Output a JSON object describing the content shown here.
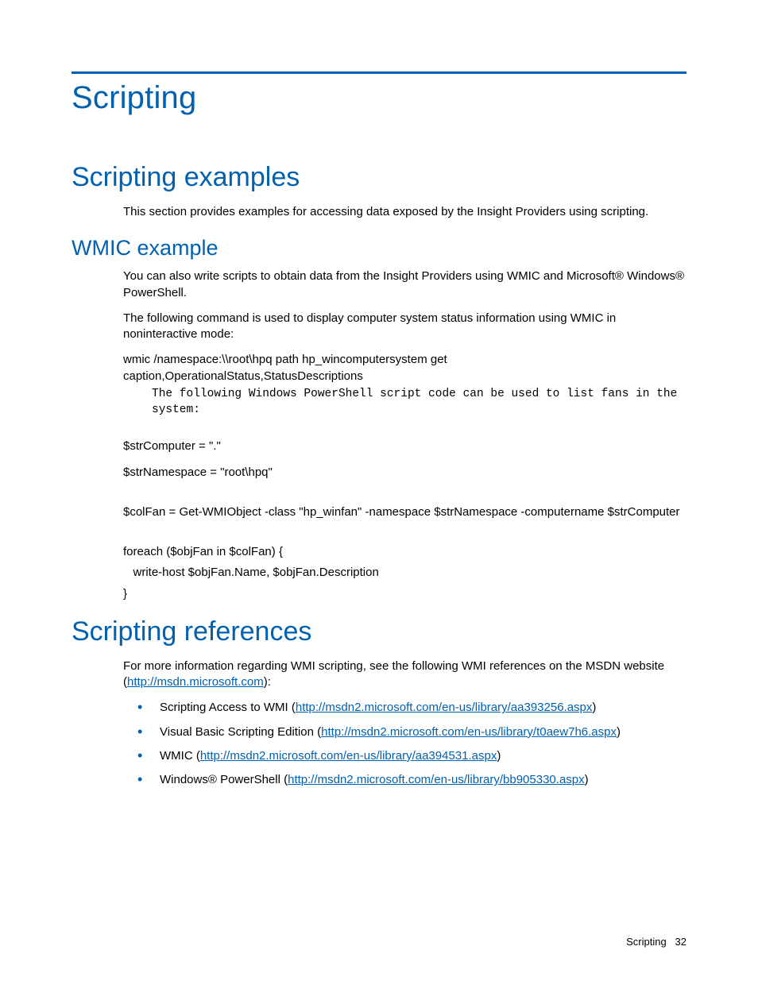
{
  "page_title": "Scripting",
  "s1": {
    "heading": "Scripting examples",
    "intro": "This section provides examples for accessing data exposed by the Insight Providers using scripting.",
    "sub": {
      "heading": "WMIC example",
      "p1": "You can also write scripts to obtain data from the Insight Providers using WMIC and Microsoft® Windows® PowerShell.",
      "p2": "The following command is used to display computer system status information using WMIC in noninteractive mode:",
      "cmd1_l1": "wmic /namespace:\\\\root\\hpq path hp_wincomputersystem get",
      "cmd1_l2": "caption,OperationalStatus,StatusDescriptions",
      "mono": "The following Windows PowerShell script code can be used to list fans in the system:",
      "ps1": "$strComputer = \".\"",
      "ps2": "$strNamespace = \"root\\hpq\"",
      "ps3": "$colFan = Get-WMIObject -class \"hp_winfan\" -namespace $strNamespace -computername $strComputer",
      "ps4": "foreach ($objFan in $colFan) {",
      "ps5": "   write-host $objFan.Name, $objFan.Description",
      "ps6": "}"
    }
  },
  "s2": {
    "heading": "Scripting references",
    "intro_pre": "For more information regarding WMI scripting, see the following WMI references on the MSDN website (",
    "intro_link": "http://msdn.microsoft.com",
    "intro_post": "):",
    "items": [
      {
        "label": "Scripting Access to WMI (",
        "url": "http://msdn2.microsoft.com/en-us/library/aa393256.aspx",
        "tail": ")"
      },
      {
        "label": "Visual Basic Scripting Edition (",
        "url": "http://msdn2.microsoft.com/en-us/library/t0aew7h6.aspx",
        "tail": ")"
      },
      {
        "label": "WMIC (",
        "url": "http://msdn2.microsoft.com/en-us/library/aa394531.aspx",
        "tail": ")"
      },
      {
        "label": "Windows® PowerShell (",
        "url": "http://msdn2.microsoft.com/en-us/library/bb905330.aspx",
        "tail": ")"
      }
    ]
  },
  "footer": {
    "section": "Scripting",
    "page": "32"
  }
}
